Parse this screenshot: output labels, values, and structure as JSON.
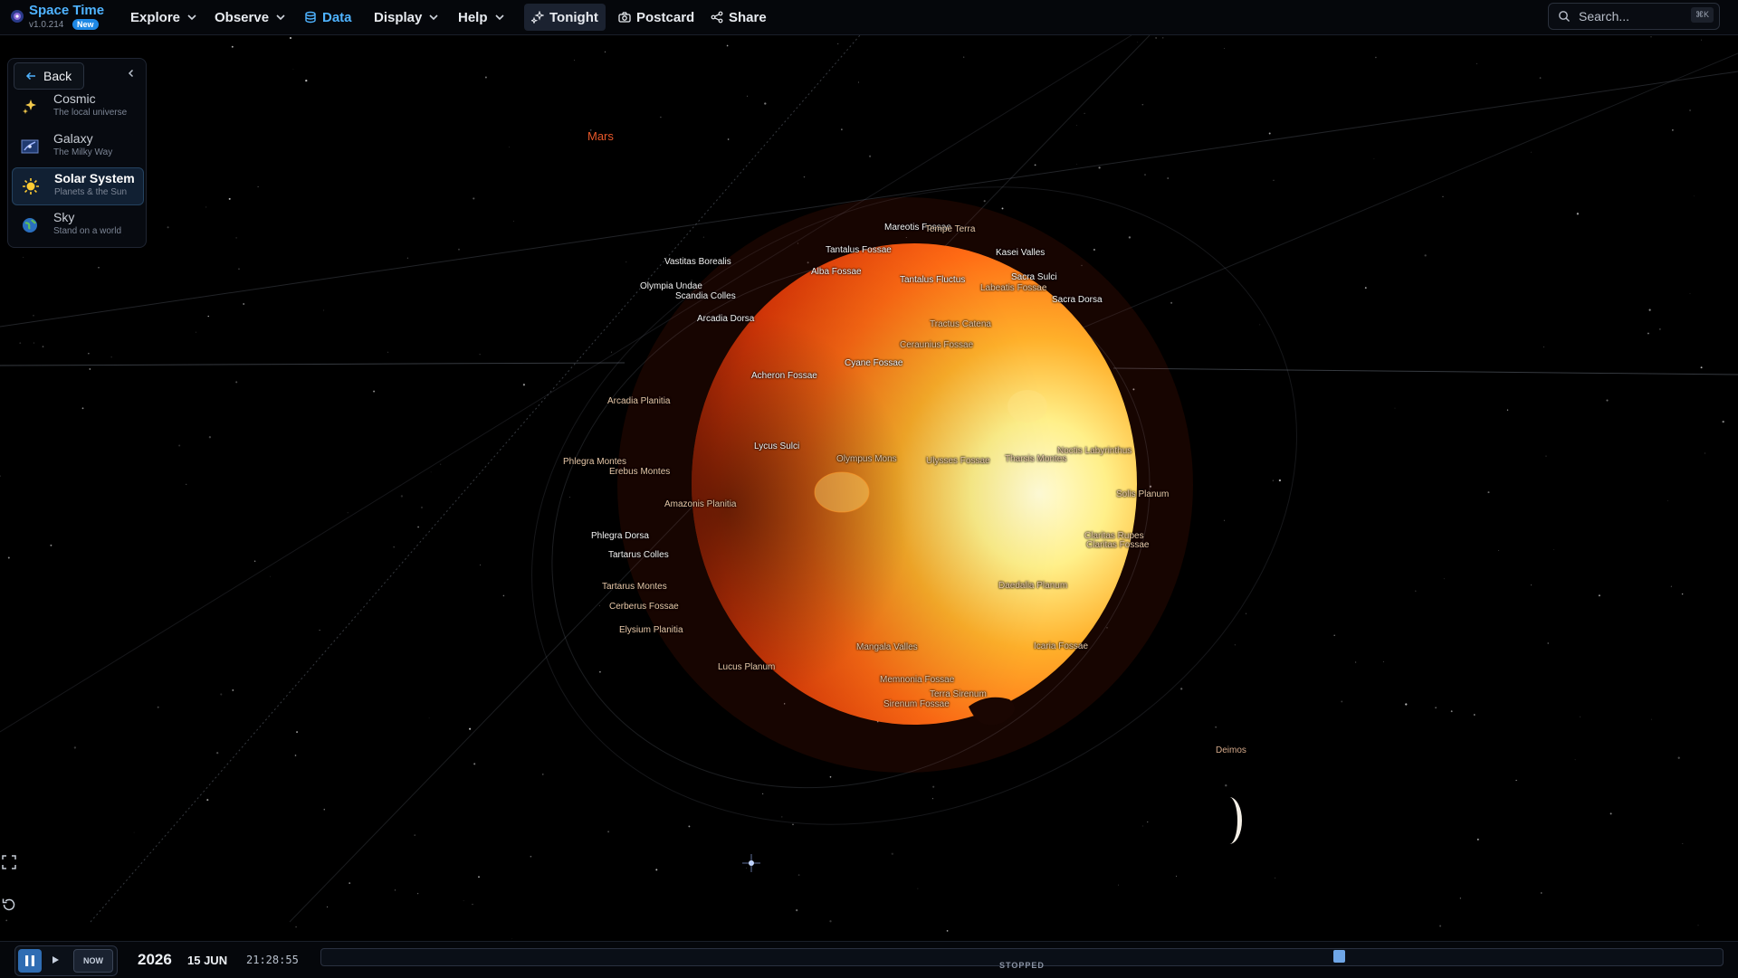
{
  "brand": {
    "name": "Space Time",
    "version": "v1.0.214",
    "badge": "New"
  },
  "nav": {
    "explore": "Explore",
    "observe": "Observe",
    "data": "Data",
    "display": "Display",
    "help": "Help",
    "tonight": "Tonight",
    "postcard": "Postcard",
    "share": "Share"
  },
  "search": {
    "placeholder": "Search...",
    "shortcut": "⌘K"
  },
  "scale_panel": {
    "back_label": "Back",
    "items": [
      {
        "title": "Cosmic",
        "subtitle": "The local universe",
        "icon": "sparkle-icon",
        "selected": false
      },
      {
        "title": "Galaxy",
        "subtitle": "The Milky Way",
        "icon": "galaxy-icon",
        "selected": false
      },
      {
        "title": "Solar System",
        "subtitle": "Planets & the Sun",
        "icon": "sun-icon",
        "selected": true
      },
      {
        "title": "Sky",
        "subtitle": "Stand on a world",
        "icon": "globe-icon",
        "selected": false
      }
    ]
  },
  "scene": {
    "planet": "Mars",
    "moon": "Deimos",
    "features": [
      "Mareotis Fossae",
      "Tempe Terra",
      "Tantalus Fossae",
      "Kasei Valles",
      "Vastitas Borealis",
      "Alba Fossae",
      "Tantalus Fluctus",
      "Sacra Sulci",
      "Labeatis Fossae",
      "Olympia Undae",
      "Scandia Colles",
      "Sacra Dorsa",
      "Tractus Catena",
      "Arcadia Dorsa",
      "Ceraunius Fossae",
      "Cyane Fossae",
      "Acheron Fossae",
      "Arcadia Planitia",
      "Lycus Sulci",
      "Noctis Labyrinthus",
      "Olympus Mons",
      "Ulysses Fossae",
      "Tharsis Montes",
      "Phlegra Montes",
      "Erebus Montes",
      "Solis Planum",
      "Amazonis Planitia",
      "Claritas Rupes",
      "Claritas Fossae",
      "Phlegra Dorsa",
      "Tartarus Colles",
      "Daedalia Planum",
      "Tartarus Montes",
      "Cerberus Fossae",
      "Elysium Planitia",
      "Icaria Fossae",
      "Mangala Valles",
      "Lucus Planum",
      "Memnonia Fossae",
      "Terra Sirenum",
      "Sirenum Fossae"
    ]
  },
  "timebar": {
    "year": "2026",
    "date": "15 JUN",
    "time": "21:28:55",
    "now_label": "NOW",
    "status": "STOPPED",
    "slider_position": 0.5
  },
  "colors": {
    "accent": "#4fb3ff",
    "mars_label": "#e8582a",
    "badge": "#1e88e5"
  }
}
